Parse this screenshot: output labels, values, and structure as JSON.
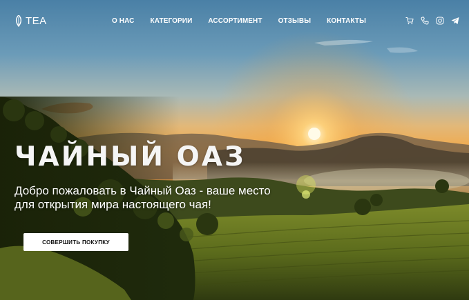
{
  "brand": {
    "logo_text": "TEA"
  },
  "nav": {
    "items": [
      {
        "label": "О НАС"
      },
      {
        "label": "КАТЕГОРИИ"
      },
      {
        "label": "АССОРТИМЕНТ"
      },
      {
        "label": "ОТЗЫВЫ"
      },
      {
        "label": "КОНТАКТЫ"
      }
    ]
  },
  "header_icons": [
    "cart-icon",
    "phone-icon",
    "instagram-icon",
    "telegram-icon"
  ],
  "hero": {
    "title": "ЧАЙНЫЙ ОАЗ",
    "subtitle": "Добро пожаловать в Чайный Оаз - ваше место для открытия мира настоящего чая!",
    "cta_label": "СОВЕРШИТЬ ПОКУПКУ"
  },
  "colors": {
    "sky_top": "#4f86a8",
    "sky_horizon": "#f0b55a",
    "sun": "#fff6d0",
    "hills": "#2e3a1a",
    "field": "#5b6a1c",
    "text": "#ffffff",
    "button_bg": "#ffffff"
  }
}
